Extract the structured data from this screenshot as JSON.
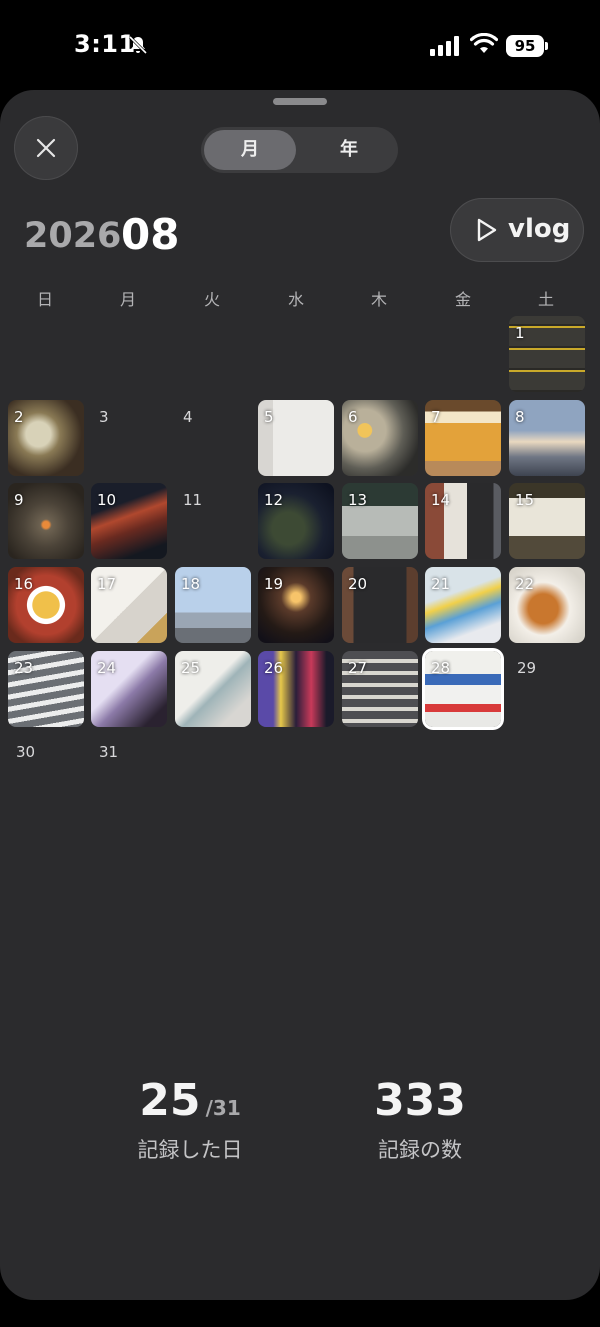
{
  "status_bar": {
    "time": "3:11",
    "battery": "95"
  },
  "segment": {
    "month_label": "月",
    "year_label": "年",
    "selected": "月"
  },
  "header": {
    "year": "2026",
    "month": "08",
    "vlog_label": "vlog"
  },
  "weekdays": [
    "日",
    "月",
    "火",
    "水",
    "木",
    "金",
    "土"
  ],
  "calendar": {
    "today": 28,
    "days": [
      {
        "day": "1",
        "photo": true
      },
      {
        "day": "2",
        "photo": true
      },
      {
        "day": "3",
        "photo": false
      },
      {
        "day": "4",
        "photo": false
      },
      {
        "day": "5",
        "photo": true
      },
      {
        "day": "6",
        "photo": true
      },
      {
        "day": "7",
        "photo": true
      },
      {
        "day": "8",
        "photo": true
      },
      {
        "day": "9",
        "photo": true
      },
      {
        "day": "10",
        "photo": true
      },
      {
        "day": "11",
        "photo": false
      },
      {
        "day": "12",
        "photo": true
      },
      {
        "day": "13",
        "photo": true
      },
      {
        "day": "14",
        "photo": true
      },
      {
        "day": "15",
        "photo": true
      },
      {
        "day": "16",
        "photo": true
      },
      {
        "day": "17",
        "photo": true
      },
      {
        "day": "18",
        "photo": true
      },
      {
        "day": "19",
        "photo": true
      },
      {
        "day": "20",
        "photo": true
      },
      {
        "day": "21",
        "photo": true
      },
      {
        "day": "22",
        "photo": true
      },
      {
        "day": "23",
        "photo": true
      },
      {
        "day": "24",
        "photo": true
      },
      {
        "day": "25",
        "photo": true
      },
      {
        "day": "26",
        "photo": true
      },
      {
        "day": "27",
        "photo": true
      },
      {
        "day": "28",
        "photo": true
      },
      {
        "day": "29",
        "photo": false
      },
      {
        "day": "30",
        "photo": false
      },
      {
        "day": "31",
        "photo": false
      }
    ]
  },
  "stats": {
    "recorded_days": "25",
    "recorded_days_total": "/31",
    "recorded_days_label": "記録した日",
    "record_count": "333",
    "record_count_label": "記録の数"
  }
}
